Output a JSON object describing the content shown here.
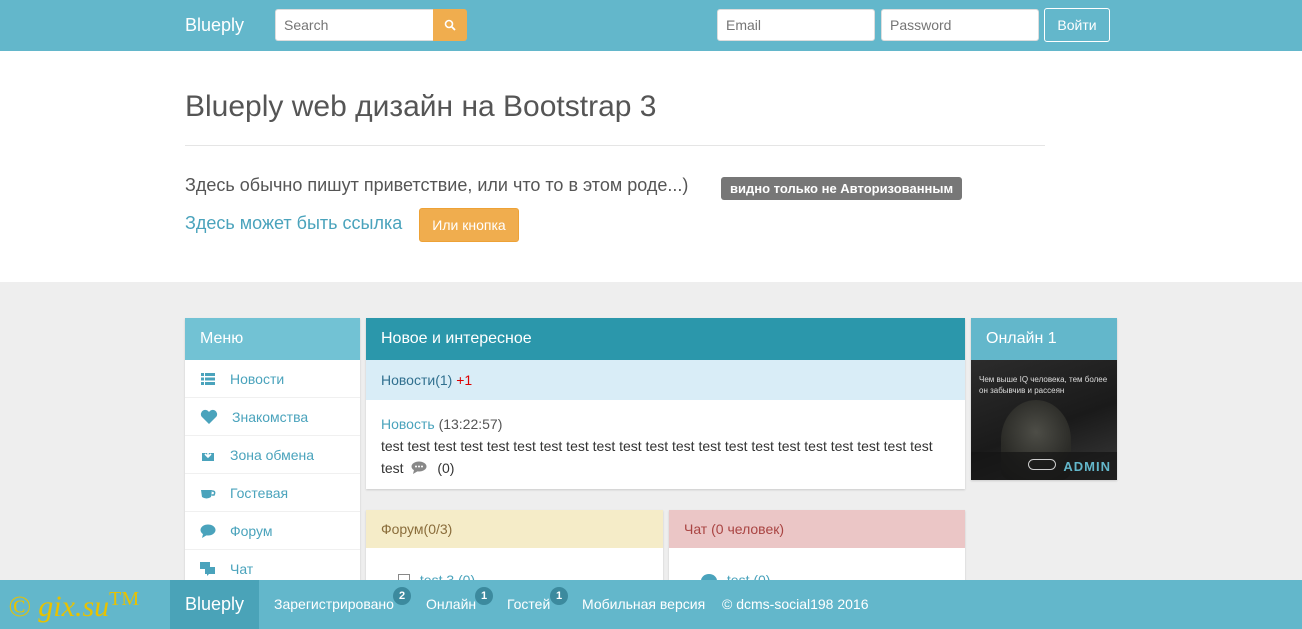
{
  "navbar": {
    "brand": "Blueply",
    "search_placeholder": "Search",
    "email_placeholder": "Email",
    "password_placeholder": "Password",
    "login_label": "Войти"
  },
  "jumbotron": {
    "title": "Blueply web дизайн на Bootstrap 3",
    "text": "Здесь обычно пишут приветствие, или что то в этом роде...)",
    "label": "видно только не Авторизованным",
    "link": "Здесь может быть ссылка",
    "button": "Или кнопка"
  },
  "menu": {
    "title": "Меню",
    "items": [
      {
        "label": "Новости",
        "icon": "list-icon"
      },
      {
        "label": "Знакомства",
        "icon": "heart-icon"
      },
      {
        "label": "Зона обмена",
        "icon": "download-icon"
      },
      {
        "label": "Гостевая",
        "icon": "cup-icon"
      },
      {
        "label": "Форум",
        "icon": "comment-icon"
      },
      {
        "label": "Чат",
        "icon": "chat-icon"
      }
    ]
  },
  "news": {
    "title": "Новое и интересное",
    "section": "Новости(1)",
    "new_count": "+1",
    "item_link": "Новость",
    "item_time": "(13:22:57)",
    "item_text": "test test test test test test test test test test test test test test test test test test test test test test",
    "comments": "(0)"
  },
  "online": {
    "title": "Онлайн 1",
    "avatar_quote": "Чем выше IQ человека, тем более он забывчив и рассеян",
    "avatar_name": "ADMIN"
  },
  "forum": {
    "title": "Форум(0/3)",
    "peek": "test 3 (0)"
  },
  "chat": {
    "title": "Чат (0 человек)",
    "peek": "test (0)"
  },
  "footer": {
    "brand": "Blueply",
    "items": [
      {
        "label": "Зарегистрировано",
        "badge": "2"
      },
      {
        "label": "Онлайн",
        "badge": "1"
      },
      {
        "label": "Гостей",
        "badge": "1"
      },
      {
        "label": "Мобильная версия"
      }
    ],
    "copyright": "© dcms-social198 2016"
  },
  "watermark": {
    "text": "© gix.su",
    "tm": "TM"
  },
  "colors": {
    "primary": "#63b7cb",
    "accent": "#f0ad4e",
    "news_header": "#2b97ab",
    "forum_header": "#f5ecc8",
    "chat_header": "#ebc6c6"
  }
}
